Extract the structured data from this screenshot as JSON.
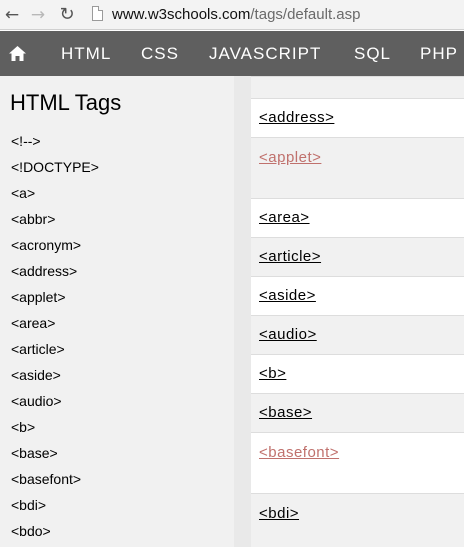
{
  "browser": {
    "url_host": "www.w3schools.com",
    "url_path": "/tags/default.asp"
  },
  "topnav": {
    "items": [
      "HTML",
      "CSS",
      "JAVASCRIPT",
      "SQL",
      "PHP"
    ]
  },
  "sidebar": {
    "title": "HTML Tags",
    "items": [
      "<!-->",
      "<!DOCTYPE>",
      "<a>",
      "<abbr>",
      "<acronym>",
      "<address>",
      "<applet>",
      "<area>",
      "<article>",
      "<aside>",
      "<audio>",
      "<b>",
      "<base>",
      "<basefont>",
      "<bdi>",
      "<bdo>"
    ]
  },
  "table": {
    "rows": [
      {
        "tag": "<address>",
        "deprecated": false
      },
      {
        "tag": "<applet>",
        "deprecated": true
      },
      {
        "tag": "<area>",
        "deprecated": false
      },
      {
        "tag": "<article>",
        "deprecated": false
      },
      {
        "tag": "<aside>",
        "deprecated": false
      },
      {
        "tag": "<audio>",
        "deprecated": false
      },
      {
        "tag": "<b>",
        "deprecated": false
      },
      {
        "tag": "<base>",
        "deprecated": false
      },
      {
        "tag": "<basefont>",
        "deprecated": true
      },
      {
        "tag": "<bdi>",
        "deprecated": false
      }
    ]
  },
  "colors": {
    "topnav_bg": "#5f5f5f",
    "sidebar_bg": "#f1f1f1",
    "deprecated_link": "#c0716d"
  },
  "icons": [
    "back-arrow-icon",
    "forward-arrow-icon",
    "reload-icon",
    "page-icon",
    "home-icon"
  ]
}
